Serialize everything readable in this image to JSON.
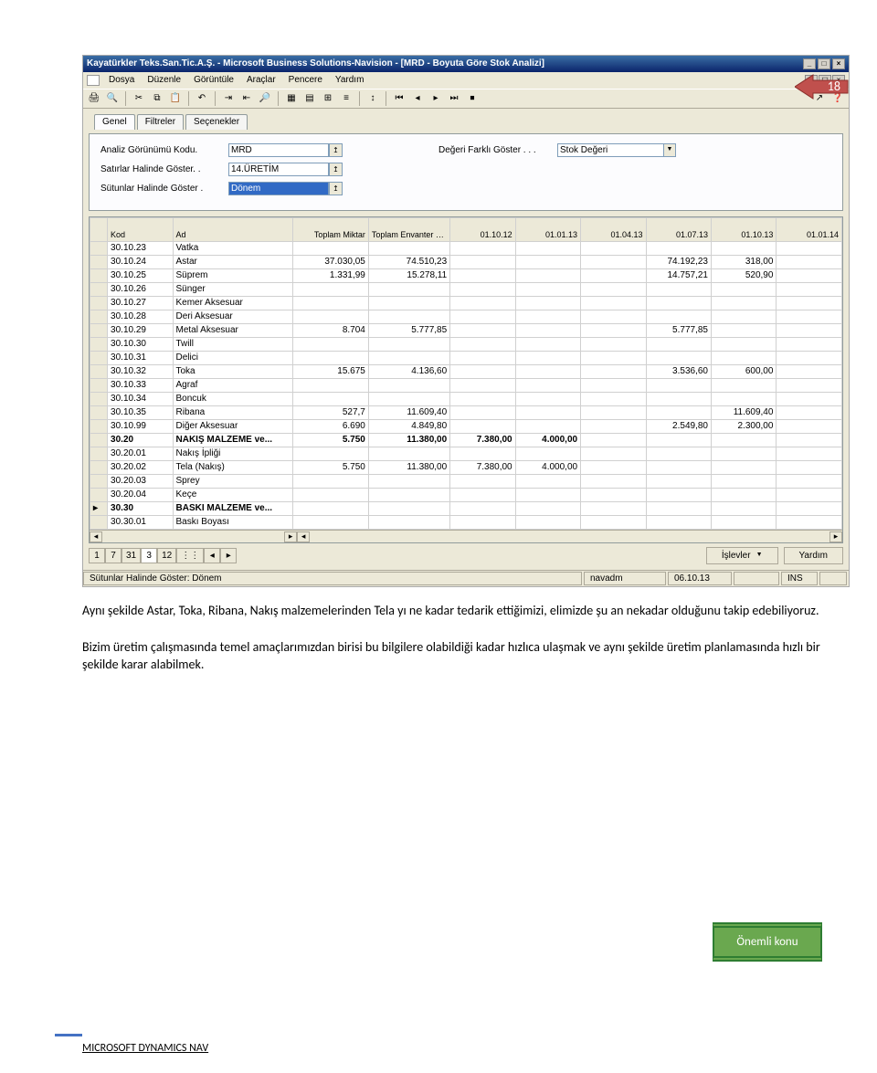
{
  "page_number": "18",
  "window": {
    "title": "Kayatürkler Teks.San.Tic.A.Ş. - Microsoft Business Solutions-Navision - [MRD - Boyuta Göre Stok Analizi]"
  },
  "menu": [
    "Dosya",
    "Düzenle",
    "Görüntüle",
    "Araçlar",
    "Pencere",
    "Yardım"
  ],
  "tabs": {
    "genel": "Genel",
    "filtreler": "Filtreler",
    "secenekler": "Seçenekler"
  },
  "filters": {
    "analiz_kod_label": "Analiz Görünümü Kodu.",
    "analiz_kod_value": "MRD",
    "degeri_label": "Değeri Farklı Göster . . .",
    "degeri_value": "Stok Değeri",
    "satirlar_label": "Satırlar Halinde Göster. .",
    "satirlar_value": "14.ÜRETİM",
    "sutunlar_label": "Sütunlar Halinde Göster .",
    "sutunlar_value": "Dönem"
  },
  "grid": {
    "headers": [
      "",
      "Kod",
      "Ad",
      "Toplam Miktar",
      "Toplam Envanter De...",
      "01.10.12",
      "01.01.13",
      "01.04.13",
      "01.07.13",
      "01.10.13",
      "01.01.14"
    ],
    "rows": [
      {
        "kod": "30.10.23",
        "ad": "Vatka",
        "tm": "",
        "te": "",
        "c1": "",
        "c2": "",
        "c3": "",
        "c4": "",
        "c5": "",
        "c6": ""
      },
      {
        "kod": "30.10.24",
        "ad": "Astar",
        "tm": "37.030,05",
        "te": "74.510,23",
        "c1": "",
        "c2": "",
        "c3": "",
        "c4": "74.192,23",
        "c5": "318,00",
        "c6": ""
      },
      {
        "kod": "30.10.25",
        "ad": "Süprem",
        "tm": "1.331,99",
        "te": "15.278,11",
        "c1": "",
        "c2": "",
        "c3": "",
        "c4": "14.757,21",
        "c5": "520,90",
        "c6": ""
      },
      {
        "kod": "30.10.26",
        "ad": "Sünger",
        "tm": "",
        "te": "",
        "c1": "",
        "c2": "",
        "c3": "",
        "c4": "",
        "c5": "",
        "c6": ""
      },
      {
        "kod": "30.10.27",
        "ad": "Kemer Aksesuar",
        "tm": "",
        "te": "",
        "c1": "",
        "c2": "",
        "c3": "",
        "c4": "",
        "c5": "",
        "c6": ""
      },
      {
        "kod": "30.10.28",
        "ad": "Deri Aksesuar",
        "tm": "",
        "te": "",
        "c1": "",
        "c2": "",
        "c3": "",
        "c4": "",
        "c5": "",
        "c6": ""
      },
      {
        "kod": "30.10.29",
        "ad": "Metal Aksesuar",
        "tm": "8.704",
        "te": "5.777,85",
        "c1": "",
        "c2": "",
        "c3": "",
        "c4": "5.777,85",
        "c5": "",
        "c6": ""
      },
      {
        "kod": "30.10.30",
        "ad": "Twill",
        "tm": "",
        "te": "",
        "c1": "",
        "c2": "",
        "c3": "",
        "c4": "",
        "c5": "",
        "c6": ""
      },
      {
        "kod": "30.10.31",
        "ad": "Delici",
        "tm": "",
        "te": "",
        "c1": "",
        "c2": "",
        "c3": "",
        "c4": "",
        "c5": "",
        "c6": ""
      },
      {
        "kod": "30.10.32",
        "ad": "Toka",
        "tm": "15.675",
        "te": "4.136,60",
        "c1": "",
        "c2": "",
        "c3": "",
        "c4": "3.536,60",
        "c5": "600,00",
        "c6": ""
      },
      {
        "kod": "30.10.33",
        "ad": "Agraf",
        "tm": "",
        "te": "",
        "c1": "",
        "c2": "",
        "c3": "",
        "c4": "",
        "c5": "",
        "c6": ""
      },
      {
        "kod": "30.10.34",
        "ad": "Boncuk",
        "tm": "",
        "te": "",
        "c1": "",
        "c2": "",
        "c3": "",
        "c4": "",
        "c5": "",
        "c6": ""
      },
      {
        "kod": "30.10.35",
        "ad": "Ribana",
        "tm": "527,7",
        "te": "11.609,40",
        "c1": "",
        "c2": "",
        "c3": "",
        "c4": "",
        "c5": "11.609,40",
        "c6": ""
      },
      {
        "kod": "30.10.99",
        "ad": "Diğer Aksesuar",
        "tm": "6.690",
        "te": "4.849,80",
        "c1": "",
        "c2": "",
        "c3": "",
        "c4": "2.549,80",
        "c5": "2.300,00",
        "c6": ""
      },
      {
        "kod": "30.20",
        "ad": "NAKIŞ MALZEME ve...",
        "tm": "5.750",
        "te": "11.380,00",
        "c1": "7.380,00",
        "c2": "4.000,00",
        "c3": "",
        "c4": "",
        "c5": "",
        "c6": "",
        "bold": true
      },
      {
        "kod": "30.20.01",
        "ad": "Nakış İpliği",
        "tm": "",
        "te": "",
        "c1": "",
        "c2": "",
        "c3": "",
        "c4": "",
        "c5": "",
        "c6": ""
      },
      {
        "kod": "30.20.02",
        "ad": "Tela (Nakış)",
        "tm": "5.750",
        "te": "11.380,00",
        "c1": "7.380,00",
        "c2": "4.000,00",
        "c3": "",
        "c4": "",
        "c5": "",
        "c6": ""
      },
      {
        "kod": "30.20.03",
        "ad": "Sprey",
        "tm": "",
        "te": "",
        "c1": "",
        "c2": "",
        "c3": "",
        "c4": "",
        "c5": "",
        "c6": ""
      },
      {
        "kod": "30.20.04",
        "ad": "Keçe",
        "tm": "",
        "te": "",
        "c1": "",
        "c2": "",
        "c3": "",
        "c4": "",
        "c5": "",
        "c6": ""
      },
      {
        "kod": "30.30",
        "ad": "BASKI MALZEME ve...",
        "tm": "",
        "te": "",
        "c1": "",
        "c2": "",
        "c3": "",
        "c4": "",
        "c5": "",
        "c6": "",
        "bold": true,
        "marker": "▸"
      },
      {
        "kod": "30.30.01",
        "ad": "Baskı Boyası",
        "tm": "",
        "te": "",
        "c1": "",
        "c2": "",
        "c3": "",
        "c4": "",
        "c5": "",
        "c6": ""
      }
    ]
  },
  "nav": {
    "btns": [
      "1",
      "7",
      "31",
      "3",
      "12",
      "⋮⋮",
      "◂",
      "▸"
    ]
  },
  "actions": {
    "islevler": "İşlevler",
    "yardim": "Yardım"
  },
  "status": {
    "label": "Sütunlar Halinde Göster: Dönem",
    "user": "navadm",
    "date": "06.10.13",
    "ins": "INS"
  },
  "paragraph1": "Aynı şekilde Astar, Toka, Ribana, Nakış malzemelerinden Tela yı ne kadar tedarik ettiğimizi, elimizde şu an nekadar olduğunu takip edebiliyoruz.",
  "paragraph2": "Bizim üretim çalışmasında temel amaçlarımızdan birisi bu bilgilere olabildiği kadar hızlıca ulaşmak ve aynı şekilde üretim planlamasında hızlı bir şekilde karar alabilmek.",
  "green_box": "Önemli konu",
  "footer": "MICROSOFT DYNAMICS NAV"
}
